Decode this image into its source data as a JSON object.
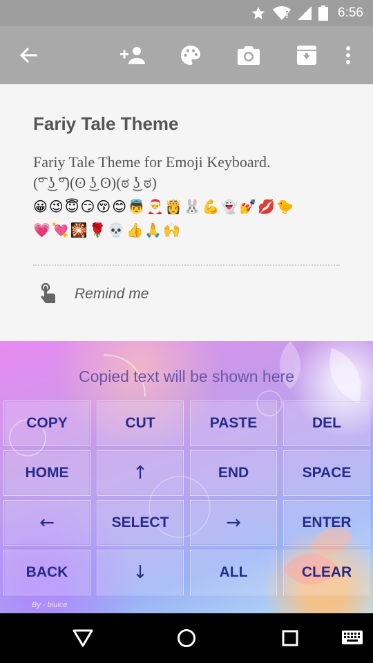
{
  "status_bar": {
    "time": "6:56"
  },
  "toolbar": {
    "icons": [
      "back-arrow-icon",
      "add-person-icon",
      "palette-icon",
      "camera-icon",
      "archive-icon",
      "more-vert-icon"
    ]
  },
  "content": {
    "title": "Fariy Tale Theme",
    "description_line1": "Fariy Tale Theme for Emoji Keyboard.",
    "description_line2": "(͡° ͜ʖ ͡°)(ʘ ͜ʖ ʘ)(ಠ ͜ʖ ಠ)",
    "emoji_row1": "😀😉😇😏😚😊👼🎅👸🐰💪👻💅💋🐤",
    "emoji_row2": "💗💘🎇🌹💀👍🙏🙌",
    "remind_label": "Remind me"
  },
  "keyboard": {
    "hint": "Copied text will be shown here",
    "rows": [
      [
        "COPY",
        "CUT",
        "PASTE",
        "DEL"
      ],
      [
        "HOME",
        "↑",
        "END",
        "SPACE"
      ],
      [
        "←",
        "SELECT",
        "→",
        "ENTER"
      ],
      [
        "BACK",
        "↓",
        "ALL",
        "CLEAR"
      ]
    ],
    "credit": "By - bluice"
  },
  "nav_bar": {
    "icons": [
      "back-triangle-icon",
      "home-circle-icon",
      "recents-square-icon",
      "keyboard-icon"
    ]
  }
}
